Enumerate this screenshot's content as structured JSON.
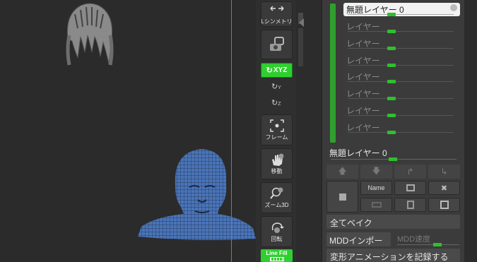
{
  "shelf": {
    "lightbox_label": "Lシンメトリ",
    "xyz_label": "XYZ",
    "rot_y_label": "Y",
    "rot_z_label": "Z",
    "frame_label": "フレーム",
    "move_label": "移動",
    "zoom_label": "ズーム3D",
    "rotate_label": "回転",
    "linefill_label": "Line Fill"
  },
  "layers": {
    "active": {
      "name": "無題レイヤー 0",
      "value": 0.45
    },
    "items": [
      {
        "name": "レイヤー"
      },
      {
        "name": "レイヤー"
      },
      {
        "name": "レイヤー"
      },
      {
        "name": "レイヤー"
      },
      {
        "name": "レイヤー"
      },
      {
        "name": "レイヤー"
      },
      {
        "name": "レイヤー"
      }
    ],
    "current": {
      "name": "無題レイヤー 0",
      "value": 0.45
    }
  },
  "buttons": {
    "name_label": "Name",
    "bake_all": "全てベイク",
    "mdd_import": "MDDインポート",
    "mdd_speed": "MDD速度",
    "record_anim": "変形アニメーションを記録する"
  },
  "colors": {
    "accent": "#2fcf2f",
    "panel": "#3b3b3b",
    "mesh": "#4a74b8"
  }
}
